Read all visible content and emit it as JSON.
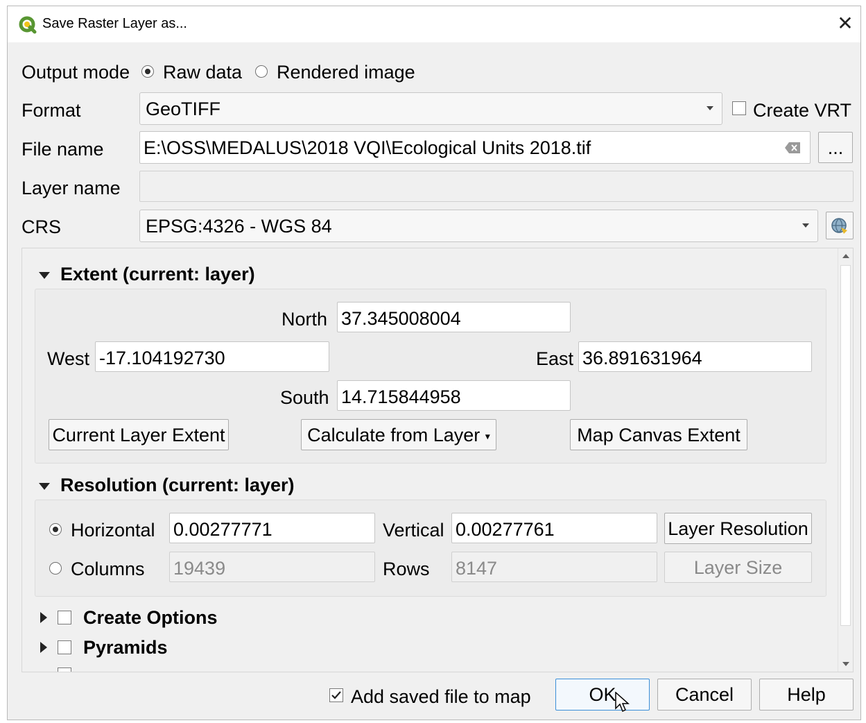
{
  "window": {
    "title": "Save Raster Layer as...",
    "close_glyph": "✕"
  },
  "form": {
    "output_mode_label": "Output mode",
    "output_mode_options": [
      "Raw data",
      "Rendered image"
    ],
    "output_mode_selected": "Raw data",
    "format_label": "Format",
    "format_value": "GeoTIFF",
    "create_vrt_label": "Create VRT",
    "filename_label": "File name",
    "filename_value": "E:\\OSS\\MEDALUS\\2018 VQI\\Ecological Units 2018.tif",
    "browse_label": "...",
    "layer_name_label": "Layer name",
    "layer_name_value": "",
    "crs_label": "CRS",
    "crs_value": "EPSG:4326 - WGS 84"
  },
  "extent": {
    "header": "Extent (current: layer)",
    "north_label": "North",
    "north_value": "37.345008004",
    "west_label": "West",
    "west_value": "-17.104192730",
    "east_label": "East",
    "east_value": "36.891631964",
    "south_label": "South",
    "south_value": "14.715844958",
    "btn_current_layer": "Current Layer Extent",
    "btn_calc_from_layer": "Calculate from Layer",
    "btn_map_canvas": "Map Canvas Extent"
  },
  "resolution": {
    "header": "Resolution (current: layer)",
    "horizontal_label": "Horizontal",
    "horizontal_value": "0.00277771",
    "vertical_label": "Vertical",
    "vertical_value": "0.00277761",
    "btn_layer_resolution": "Layer Resolution",
    "columns_label": "Columns",
    "columns_value": "19439",
    "rows_label": "Rows",
    "rows_value": "8147",
    "btn_layer_size": "Layer Size",
    "selected_mode": "Horizontal"
  },
  "sections": {
    "create_options": "Create Options",
    "pyramids": "Pyramids"
  },
  "footer": {
    "add_to_map_label": "Add saved file to map",
    "add_to_map_checked": true,
    "ok": "OK",
    "cancel": "Cancel",
    "help": "Help"
  },
  "colors": {
    "qgis_green": "#589632",
    "default_button_border": "#3b8fd8"
  }
}
